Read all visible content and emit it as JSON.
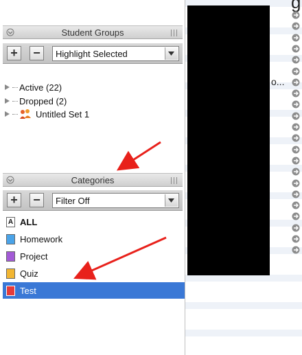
{
  "student_groups": {
    "title": "Student Groups",
    "add_label": "+",
    "remove_label": "−",
    "dropdown_value": "Highlight Selected",
    "items": [
      {
        "label": "Active (22)"
      },
      {
        "label": "Dropped (2)"
      },
      {
        "label": "Untitled Set 1"
      }
    ]
  },
  "categories": {
    "title": "Categories",
    "add_label": "+",
    "remove_label": "−",
    "dropdown_value": "Filter Off",
    "items": [
      {
        "label": "ALL",
        "icon_letter": "A",
        "color": "#ffffff"
      },
      {
        "label": "Homework",
        "icon_letter": "",
        "color": "#4aa3e8"
      },
      {
        "label": "Project",
        "icon_letter": "",
        "color": "#a35ad6"
      },
      {
        "label": "Quiz",
        "icon_letter": "",
        "color": "#f2b632"
      },
      {
        "label": "Test",
        "icon_letter": "",
        "color": "#e53b3b",
        "selected": true
      }
    ]
  },
  "right_list": {
    "truncated_text": "o...",
    "partial_header": "g"
  },
  "colors": {
    "selection": "#3a78d6",
    "annotation_arrow": "#e8211b",
    "redaction": "#000000"
  }
}
